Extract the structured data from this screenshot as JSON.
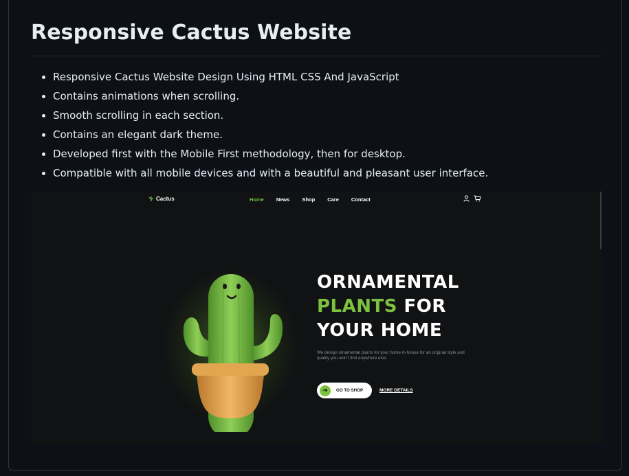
{
  "readme": {
    "title": "Responsive Cactus Website",
    "features": [
      "Responsive Cactus Website Design Using HTML CSS And JavaScript",
      "Contains animations when scrolling.",
      "Smooth scrolling in each section.",
      "Contains an elegant dark theme.",
      "Developed first with the Mobile First methodology, then for desktop.",
      "Compatible with all mobile devices and with a beautiful and pleasant user interface."
    ]
  },
  "preview": {
    "logo_text": "Cactus",
    "logo_icon": "cactus-leaf-icon",
    "nav": [
      "Home",
      "News",
      "Shop",
      "Care",
      "Contact"
    ],
    "active_nav": "Home",
    "icons": [
      "user-icon",
      "cart-icon"
    ],
    "hero": {
      "line1": "ORNAMENTAL",
      "line2_accent": "PLANTS",
      "line2_rest": " FOR",
      "line3": "YOUR HOME",
      "description": "We design ornamental plants for your home in-house for an original style and quality you won't find anywhere else.",
      "primary_button": "GO TO SHOP",
      "secondary_link": "MORE DETAILS"
    },
    "colors": {
      "accent": "#7cc240",
      "background": "#111213",
      "pot": "#e0a24a"
    }
  }
}
